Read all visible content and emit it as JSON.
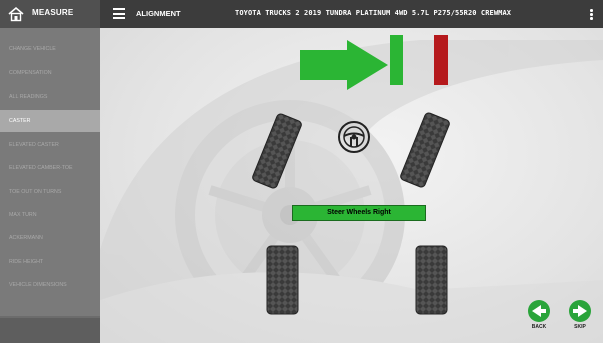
{
  "topbar": {
    "home_label": "MEASURE",
    "section_label": "ALIGNMENT",
    "vehicle": "TOYOTA TRUCKS 2 2019 TUNDRA PLATINUM 4WD 5.7L P275/55R20 CREWMAX"
  },
  "sidebar": {
    "items": [
      {
        "label": "CHANGE VEHICLE"
      },
      {
        "label": "COMPENSATION"
      },
      {
        "label": "ALL READINGS"
      },
      {
        "label": "CASTER"
      },
      {
        "label": "ELEVATED CASTER"
      },
      {
        "label": "ELEVATED CAMBER-TOE"
      },
      {
        "label": "TOE OUT ON TURNS"
      },
      {
        "label": "MAX TURN"
      },
      {
        "label": "ACKERMANN"
      },
      {
        "label": "RIDE HEIGHT"
      },
      {
        "label": "VEHICLE DIMENSIONS"
      }
    ],
    "active_index": 3
  },
  "main": {
    "instruction": "Steer Wheels Right",
    "back_label": "BACK",
    "skip_label": "SKIP"
  },
  "colors": {
    "accent_green": "#2bb534",
    "indicator_red": "#b5191c",
    "sidebar_bg": "#7a7a7a",
    "topbar_bg": "#3c3c3c"
  },
  "icons": {
    "home": "home-icon",
    "menu": "hamburger-menu-icon",
    "more": "kebab-menu-icon",
    "steering": "steering-wheel-icon",
    "direction": "arrow-right-icon",
    "back": "arrow-left-icon",
    "skip": "arrow-right-icon"
  }
}
